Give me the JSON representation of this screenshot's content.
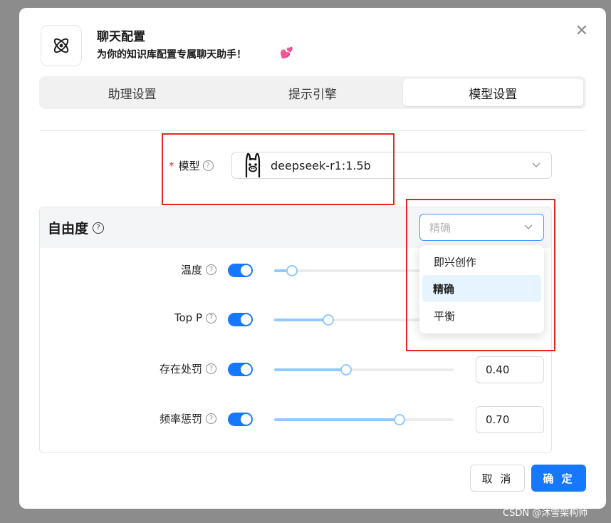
{
  "header": {
    "title": "聊天配置",
    "subtitle": "为你的知识库配置专属聊天助手！",
    "emoji": "💕"
  },
  "tabs": [
    {
      "label": "助理设置",
      "active": false
    },
    {
      "label": "提示引擎",
      "active": false
    },
    {
      "label": "模型设置",
      "active": true
    }
  ],
  "model": {
    "required_mark": "*",
    "label": "模型",
    "value": "deepseek-r1:1.5b",
    "icon": "ollama-llama-icon"
  },
  "freedom": {
    "title": "自由度",
    "select_value": "精确",
    "options": [
      "即兴创作",
      "精确",
      "平衡"
    ],
    "selected_option": "精确"
  },
  "params": [
    {
      "label": "温度",
      "enabled": true,
      "value_fraction": 0.1
    },
    {
      "label": "Top P",
      "enabled": true,
      "value_fraction": 0.3
    },
    {
      "label": "存在处罚",
      "enabled": true,
      "value_fraction": 0.4,
      "value": "0.40"
    },
    {
      "label": "频率惩罚",
      "enabled": true,
      "value_fraction": 0.7,
      "value": "0.70"
    }
  ],
  "footer": {
    "cancel_label": "取 消",
    "ok_label": "确 定"
  },
  "watermark": "CSDN @沐雪架构师",
  "colors": {
    "primary": "#1677ff",
    "slider": "#91caff",
    "highlight_box": "#e8251f"
  }
}
